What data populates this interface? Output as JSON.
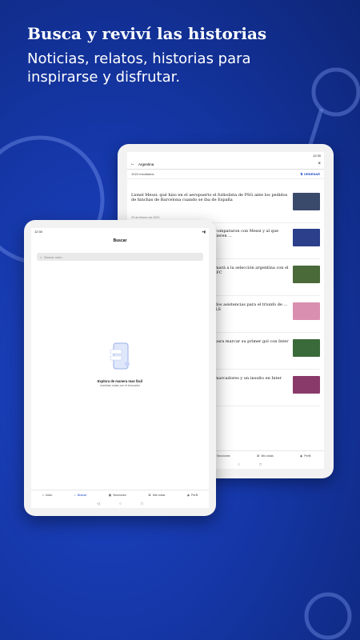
{
  "promo": {
    "title": "Busca y reviví las historias",
    "subtitle": "Noticias, relatos, historias para inspirarse y disfrutar."
  },
  "colors": {
    "accent": "#1a47c7",
    "background": "#1537a8"
  },
  "back_tablet": {
    "time": "12:30",
    "search_query": "Argentina",
    "results_count": "1024 resultados",
    "order_label": "ORDENAR",
    "articles": [
      {
        "headline": "Lionel Messi: qué hizo en el aeropuerto el futbolista de PSG ante los pedidos de hinchas de Barcelona cuando se iba de España",
        "date": "29 de febrero de 2023",
        "thumb": "#3a4a6a"
      },
      {
        "headline": "...compararon con Messi y al que quieren ...",
        "date": "",
        "thumb": "#2b3f8a"
      },
      {
        "headline": "...mará a la selección argentina con el ... FC",
        "date": "",
        "thumb": "#4a6a3a"
      },
      {
        "headline": "...dos asistencias para el triunfo de ... MLS",
        "date": "",
        "thumb": "#d98fb0"
      },
      {
        "headline": "...para marcar su primer gol con Inter",
        "date": "",
        "thumb": "#3b6a3a"
      },
      {
        "headline": "...marcadores y un insulto en Inter",
        "date": "",
        "thumb": "#8a3a6a"
      }
    ],
    "nav": {
      "sections": "Secciones",
      "my_news": "Mis notas",
      "profile": "Perfil"
    }
  },
  "front_tablet": {
    "time": "12:30",
    "title": "Buscar",
    "search_placeholder": "Buscar nota...",
    "empty_title": "Explora de manera mas fácil",
    "empty_subtitle": "nuestras notas con el buscador",
    "nav": {
      "home": "Inicio",
      "search": "Buscar",
      "sections": "Secciones",
      "my_news": "Mis notas",
      "profile": "Perfil"
    }
  }
}
